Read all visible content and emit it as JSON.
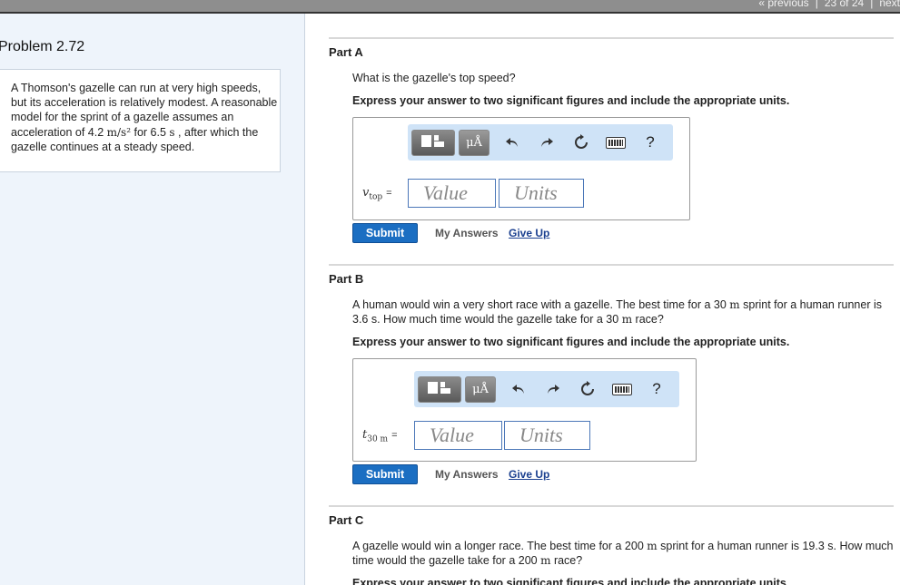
{
  "nav": {
    "previous": "« previous",
    "position": "23 of 24",
    "next": "next"
  },
  "problem": {
    "title": "Problem 2.72",
    "text_1": "A Thomson's gazelle can run at very high speeds, but its acceleration is relatively modest. A reasonable model for the sprint of a gazelle assumes an acceleration of 4.2 ",
    "accel_unit": "m/s²",
    "text_2": " for 6.5 ",
    "time_unit": "s",
    "text_3": " , after which the gazelle continues at a steady speed."
  },
  "toolbar": {
    "template_icon": "templates-icon",
    "mu_label": "μÅ",
    "undo_icon": "undo-icon",
    "redo_icon": "redo-icon",
    "reset_icon": "reset-icon",
    "keyboard_icon": "keyboard-icon",
    "help_label": "?"
  },
  "colors": {
    "submit": "#1b6ec2",
    "toolbar": "#cfe3f7",
    "field_border": "#4b77b8",
    "leftpanel": "#eef4fb"
  },
  "parts": [
    {
      "title": "Part A",
      "question": "What is the gazelle's top speed?",
      "instruction": "Express your answer to two significant figures and include the appropriate units.",
      "var": "v",
      "var_sub": "top",
      "equals": "=",
      "value_placeholder": "Value",
      "units_placeholder": "Units",
      "submit": "Submit",
      "my_answers": "My Answers",
      "give_up": "Give Up"
    },
    {
      "title": "Part B",
      "question_1": "A human would win a very short race with a gazelle. The best time for a 30 ",
      "q_unit_1": "m",
      "question_2": " sprint for a human runner is 3.6 s. How much time would the gazelle take for a 30 ",
      "q_unit_2": "m",
      "question_3": " race?",
      "instruction": "Express your answer to two significant figures and include the appropriate units.",
      "var": "t",
      "var_sub": "30 m",
      "equals": "=",
      "value_placeholder": "Value",
      "units_placeholder": "Units",
      "submit": "Submit",
      "my_answers": "My Answers",
      "give_up": "Give Up"
    },
    {
      "title": "Part C",
      "question_1": "A gazelle would win a longer race. The best time for a 200 ",
      "q_unit_1": "m",
      "question_2": " sprint for a human runner is 19.3 s. How much time would the gazelle take for a 200 ",
      "q_unit_2": "m",
      "question_3": " race?",
      "instruction": "Express your answer to two significant figures and include the appropriate units."
    }
  ]
}
